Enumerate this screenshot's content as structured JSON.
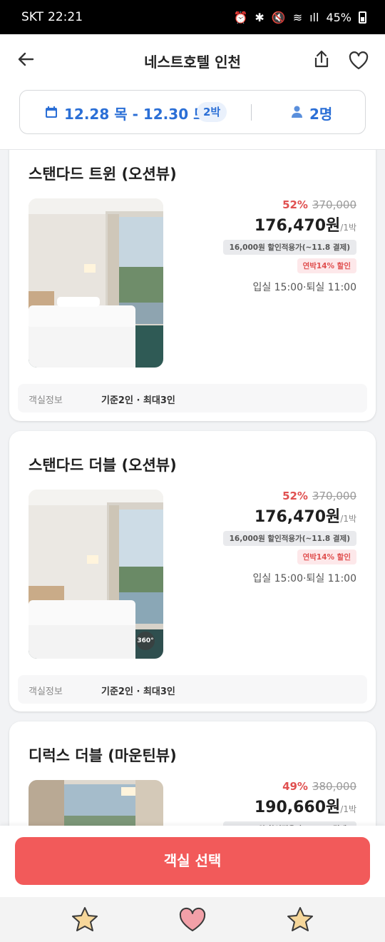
{
  "status_bar": {
    "carrier": "SKT",
    "time": "22:21",
    "battery": "45%"
  },
  "header": {
    "title": "네스트호텔 인천",
    "date_range": "12.28 목 - 12.30 토",
    "nights": "2박",
    "guests": "2명"
  },
  "rooms": [
    {
      "name": "스탠다드 트윈 (오션뷰)",
      "discount": "52%",
      "original_price": "370,000",
      "price": "176,470원",
      "per_night": "/1박",
      "coupon": "16,000원 할인적용가(~11.8 결제)",
      "longstay": "연박14% 할인",
      "checkin": "입실 15:00·퇴실 11:00",
      "info_label": "객실정보",
      "info_value": "기준2인 · 최대3인"
    },
    {
      "name": "스탠다드 더블 (오션뷰)",
      "discount": "52%",
      "original_price": "370,000",
      "price": "176,470원",
      "per_night": "/1박",
      "coupon": "16,000원 할인적용가(~11.8 결제)",
      "longstay": "연박14% 할인",
      "checkin": "입실 15:00·퇴실 11:00",
      "badge": "360°",
      "info_label": "객실정보",
      "info_value": "기준2인 · 최대3인"
    },
    {
      "name": "디럭스 더블 (마운틴뷰)",
      "discount": "49%",
      "original_price": "380,000",
      "price": "190,660원",
      "per_night": "/1박",
      "coupon": "16,000원 할인적용가(~11.8 결제)"
    }
  ],
  "cta": {
    "label": "객실 선택"
  },
  "colors": {
    "accent_blue": "#2b6fd6",
    "cta_red": "#f25a5a",
    "discount_red": "#e05050"
  },
  "nav_icons": [
    "star-icon",
    "heart-icon",
    "star-icon"
  ]
}
